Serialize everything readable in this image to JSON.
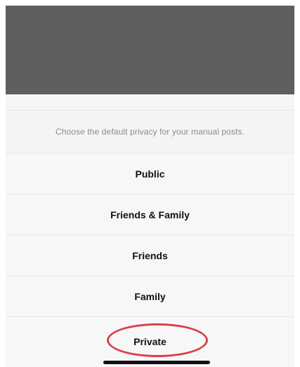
{
  "privacy_sheet": {
    "prompt": "Choose the default privacy for your manual posts.",
    "options": [
      {
        "label": "Public"
      },
      {
        "label": "Friends & Family"
      },
      {
        "label": "Friends"
      },
      {
        "label": "Family"
      },
      {
        "label": "Private"
      }
    ],
    "highlighted_option": "Private",
    "highlight_color": "#d94048"
  },
  "colors": {
    "overlay": "#5f5f5f",
    "sheet_background": "#f7f7f7",
    "divider": "#e7e7e7",
    "prompt_text": "#8b8b8b",
    "option_text": "#111111"
  }
}
